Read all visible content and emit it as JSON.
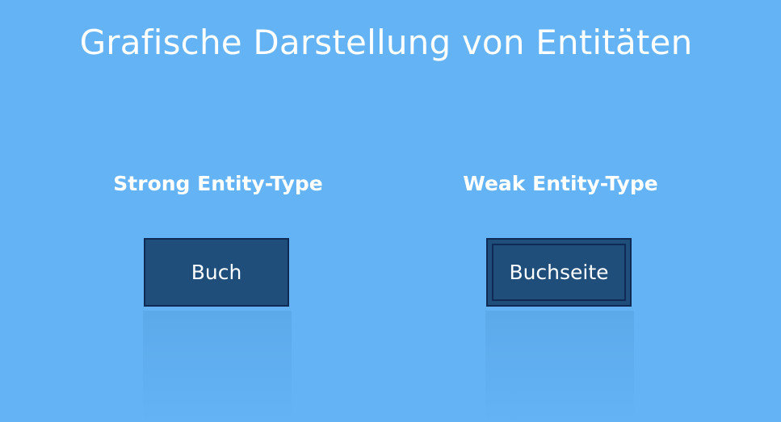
{
  "slide": {
    "title": "Grafische Darstellung von Entitäten",
    "background_color": "#63b3f5"
  },
  "diagram": {
    "strong": {
      "heading": "Strong Entity-Type",
      "entity_label": "Buch",
      "shape": "rectangle"
    },
    "weak": {
      "heading": "Weak Entity-Type",
      "entity_label": "Buchseite",
      "shape": "double-rectangle"
    },
    "colors": {
      "entity_fill": "#1f4e7b",
      "entity_border": "#0e2a55",
      "text": "#ffffff"
    }
  }
}
